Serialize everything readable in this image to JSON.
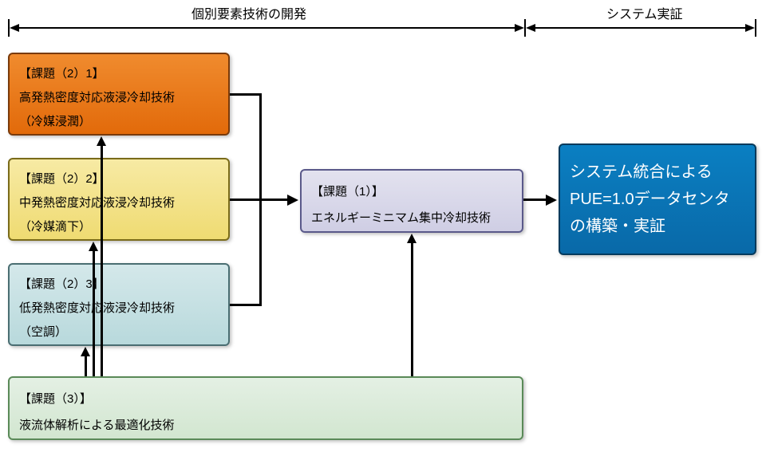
{
  "headers": {
    "left": "個別要素技術の開発",
    "right": "システム実証"
  },
  "boxes": {
    "k21": {
      "tag": "【課題（2）1】",
      "l1": "高発熱密度対応液浸冷却技術",
      "l2": "（冷媒浸潤）"
    },
    "k22": {
      "tag": "【課題（2）2】",
      "l1": "中発熱密度対応液浸冷却技術",
      "l2": "（冷媒滴下）"
    },
    "k23": {
      "tag": "【課題（2）3】",
      "l1": "低発熱密度対応液浸冷却技術",
      "l2": "（空調）"
    },
    "k1": {
      "tag": "【課題（1）】",
      "l1": "エネルギーミニマム集中冷却技術"
    },
    "k3": {
      "tag": "【課題（3）】",
      "l1": "液流体解析による最適化技術"
    },
    "sys": {
      "l1": "システム統合によるPUE=1.0データセンタの構築・実証"
    }
  }
}
